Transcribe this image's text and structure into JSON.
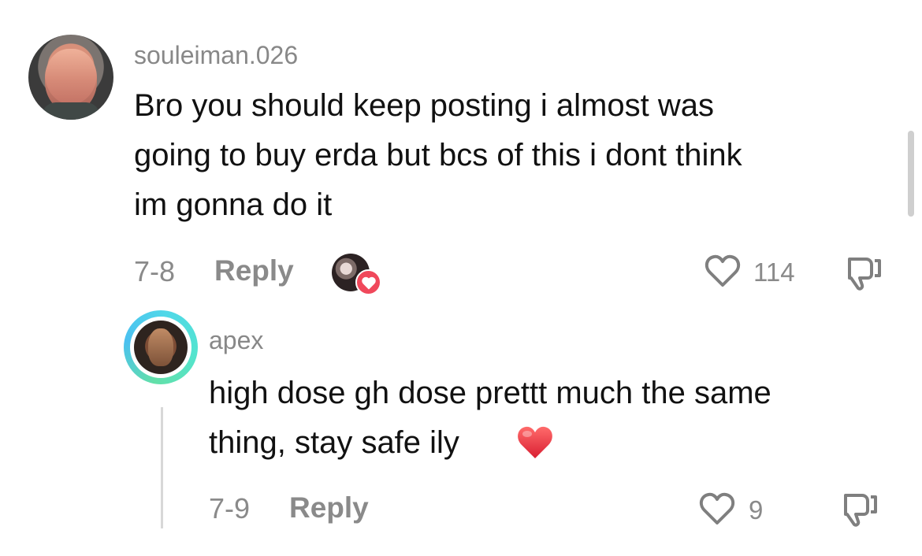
{
  "comments": [
    {
      "username": "souleiman.026",
      "text_lines": [
        "Bro you should keep posting i almost was",
        "going to buy erda but bcs of this i dont think",
        "im gonna do it"
      ],
      "date": "7-8",
      "reply_label": "Reply",
      "likes": "114"
    },
    {
      "username": "apex",
      "text_lines": [
        "high dose gh dose prettt much the same",
        "thing, stay safe ily"
      ],
      "date": "7-9",
      "reply_label": "Reply",
      "likes": "9"
    }
  ],
  "icons": {
    "heart": "heart-icon",
    "dislike": "thumbs-down-icon",
    "emoji": "red-heart-emoji"
  },
  "colors": {
    "text": "#111111",
    "secondary": "#8a8a8a",
    "accent_red": "#f0485b"
  }
}
